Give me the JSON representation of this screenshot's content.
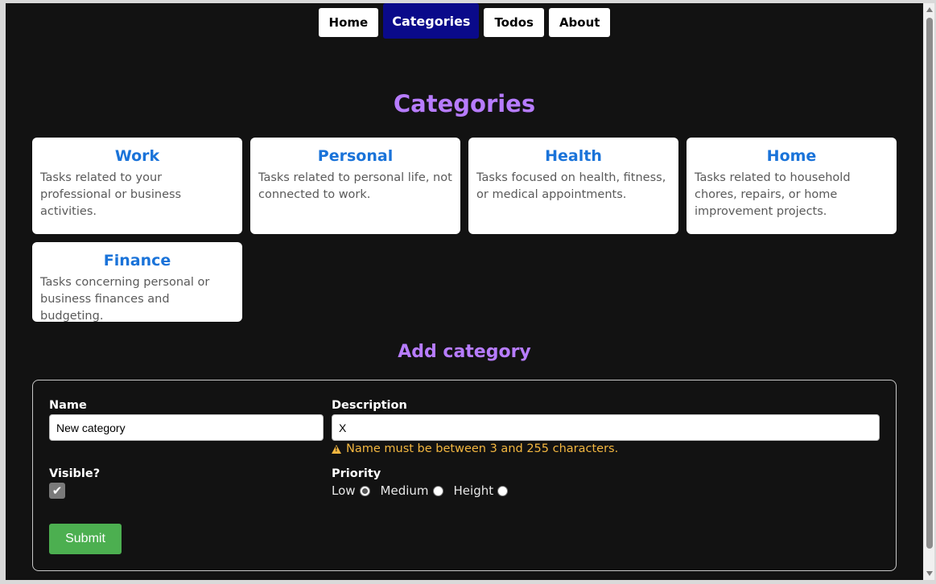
{
  "nav": {
    "items": [
      {
        "label": "Home",
        "active": false
      },
      {
        "label": "Categories",
        "active": true
      },
      {
        "label": "Todos",
        "active": false
      },
      {
        "label": "About",
        "active": false
      }
    ]
  },
  "page": {
    "title": "Categories",
    "add_title": "Add category"
  },
  "categories": [
    {
      "name": "Work",
      "description": "Tasks related to your professional or business activities."
    },
    {
      "name": "Personal",
      "description": "Tasks related to personal life, not connected to work."
    },
    {
      "name": "Health",
      "description": "Tasks focused on health, fitness, or medical appointments."
    },
    {
      "name": "Home",
      "description": "Tasks related to household chores, repairs, or home improvement projects."
    },
    {
      "name": "Finance",
      "description": "Tasks concerning personal or business finances and budgeting."
    }
  ],
  "form": {
    "name_label": "Name",
    "name_value": "New category",
    "description_label": "Description",
    "description_value": "X",
    "error_message": "Name must be between 3 and 255 characters.",
    "visible_label": "Visible?",
    "visible_checked": true,
    "priority_label": "Priority",
    "priority_options": [
      {
        "label": "Low",
        "checked": true
      },
      {
        "label": "Medium",
        "checked": false
      },
      {
        "label": "Height",
        "checked": false
      }
    ],
    "submit_label": "Submit"
  },
  "colors": {
    "background": "#121212",
    "heading": "#b77cff",
    "card_title": "#1a73d9",
    "nav_active": "#0a0a8a",
    "error": "#f2b640",
    "submit": "#4caf50"
  }
}
